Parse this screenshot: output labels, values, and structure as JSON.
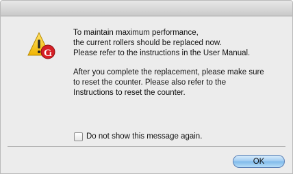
{
  "dialog": {
    "icon": "caution-app-icon",
    "message_paragraphs": [
      "To maintain maximum performance,\nthe current rollers should be replaced now.\nPlease refer to the instructions in the User Manual.",
      "After you complete the replacement, please make sure\nto reset the counter. Please also refer to the\nInstructions to reset the counter."
    ],
    "checkbox_label": "Do not show this message again.",
    "checkbox_checked": false,
    "ok_label": "OK"
  },
  "colors": {
    "warning_yellow": "#f4c41e",
    "button_blue": "#7db9ea"
  }
}
